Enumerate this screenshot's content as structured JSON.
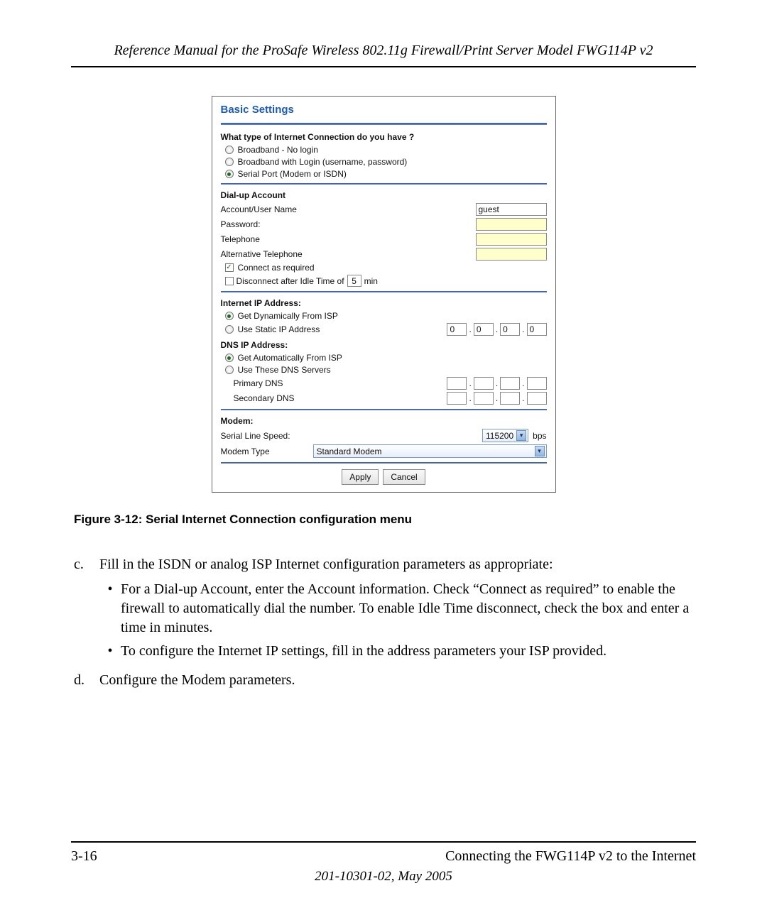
{
  "header": {
    "title": "Reference Manual for the ProSafe Wireless 802.11g  Firewall/Print Server Model FWG114P v2"
  },
  "shot": {
    "title": "Basic Settings",
    "q_head": "What type of Internet Connection do you have ?",
    "opts": {
      "a": "Broadband - No login",
      "b": "Broadband with Login (username, password)",
      "c": "Serial Port (Modem or ISDN)"
    },
    "dial": {
      "head": "Dial-up Account",
      "user_label": "Account/User Name",
      "user_value": "guest",
      "pw_label": "Password:",
      "tel_label": "Telephone",
      "alt_tel_label": "Alternative Telephone",
      "connect_label": "Connect as required",
      "disconnect_prefix": "Disconnect after Idle Time of",
      "idle_value": "5",
      "disconnect_suffix": "min"
    },
    "ip": {
      "head": "Internet IP Address:",
      "dyn": "Get Dynamically From ISP",
      "static": "Use Static IP Address",
      "vals": [
        "0",
        "0",
        "0",
        "0"
      ]
    },
    "dns": {
      "head": "DNS IP Address:",
      "auto": "Get Automatically From ISP",
      "use": "Use These DNS Servers",
      "primary": "Primary DNS",
      "secondary": "Secondary DNS"
    },
    "modem": {
      "head": "Modem:",
      "speed_label": "Serial Line Speed:",
      "speed_value": "115200",
      "speed_unit": "bps",
      "type_label": "Modem Type",
      "type_value": "Standard Modem"
    },
    "buttons": {
      "apply": "Apply",
      "cancel": "Cancel"
    }
  },
  "caption": "Figure 3-12: Serial Internet Connection configuration menu",
  "body": {
    "c_marker": "c.",
    "c_text": "Fill in the ISDN or analog ISP Internet configuration parameters as appropriate:",
    "c_b1": "For a Dial-up Account, enter the Account information. Check “Connect as required” to enable the firewall to automatically dial the number. To enable Idle Time disconnect, check the box and enter a time in minutes.",
    "c_b2": "To configure the Internet IP settings, fill in the address parameters your ISP provided.",
    "d_marker": "d.",
    "d_text": "Configure the Modem parameters."
  },
  "footer": {
    "page": "3-16",
    "section": "Connecting the FWG114P v2 to the Internet",
    "date": "201-10301-02, May 2005"
  }
}
